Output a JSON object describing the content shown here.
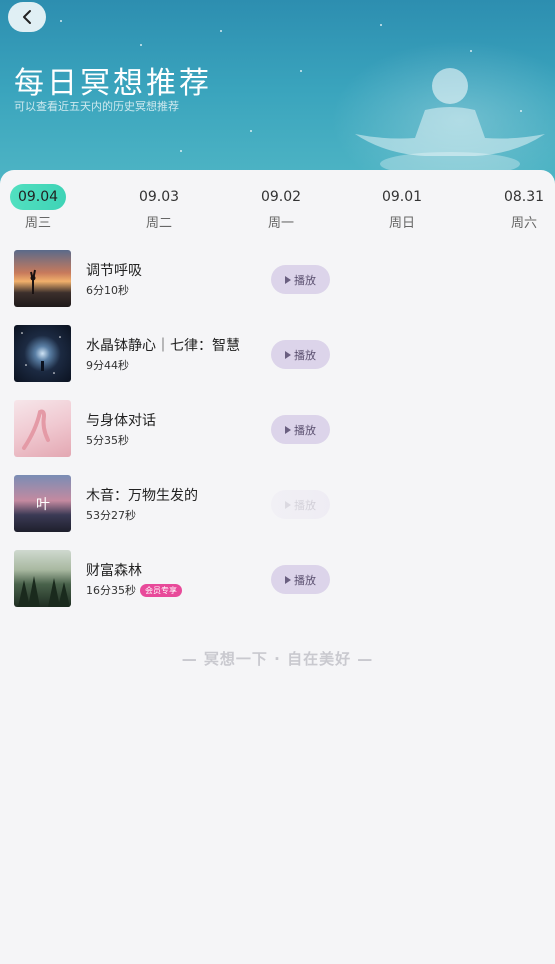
{
  "header": {
    "title": "每日冥想推荐",
    "subtitle": "可以查看近五天内的历史冥想推荐"
  },
  "dates": [
    {
      "date": "09.04",
      "weekday": "周三",
      "active": true
    },
    {
      "date": "09.03",
      "weekday": "周二",
      "active": false
    },
    {
      "date": "09.02",
      "weekday": "周一",
      "active": false
    },
    {
      "date": "09.01",
      "weekday": "周日",
      "active": false
    },
    {
      "date": "08.31",
      "weekday": "周六",
      "active": false
    }
  ],
  "items": [
    {
      "title": "调节呼吸",
      "duration": "6分10秒",
      "play_label": "播放"
    },
    {
      "title": "水晶钵静心｜七律：智慧",
      "duration": "9分44秒",
      "play_label": "播放"
    },
    {
      "title": "与身体对话",
      "duration": "5分35秒",
      "play_label": "播放"
    },
    {
      "title": "木音：万物生发的",
      "duration": "53分27秒",
      "play_label": "播放"
    },
    {
      "title": "财富森林",
      "duration": "16分35秒",
      "badge": "会员专享",
      "play_label": "播放"
    }
  ],
  "footer": {
    "tagline": "— 冥想一下 · 自在美好 —"
  },
  "colors": {
    "accent": "#3ed3b6",
    "play_bg": "#dcd4ea",
    "badge": "#e84a9a"
  }
}
